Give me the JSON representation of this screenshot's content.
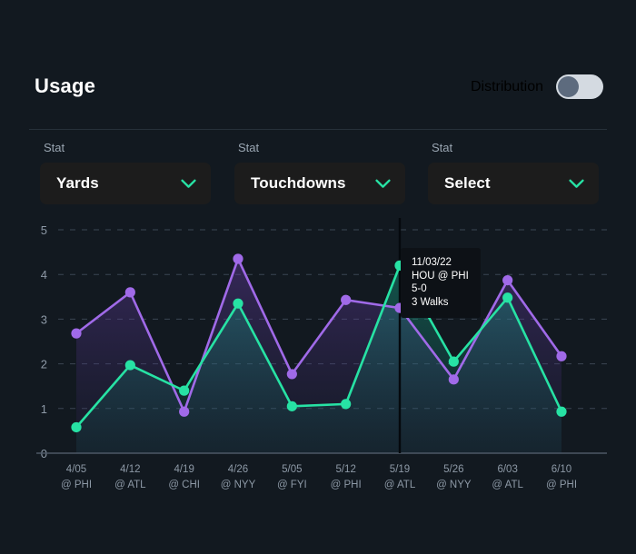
{
  "header": {
    "title": "Usage",
    "distribution_label": "Distribution",
    "toggle_state": "off"
  },
  "selectors": [
    {
      "label": "Stat",
      "value": "Yards",
      "icon": "chevron-down-icon"
    },
    {
      "label": "Stat",
      "value": "Touchdowns",
      "icon": "chevron-down-icon"
    },
    {
      "label": "Stat",
      "value": "Select",
      "icon": "chevron-down-icon"
    }
  ],
  "tooltip": {
    "date": "11/03/22",
    "matchup": "HOU @ PHI",
    "score": "5-0",
    "detail": "3 Walks"
  },
  "colors": {
    "background": "#121920",
    "series_1": "#a06ae8",
    "series_2": "#27e2a4",
    "accent": "#27e2a4",
    "grid": "#3b4653",
    "axis": "#4d5866",
    "marker_line": "#05090d",
    "panel": "#1c1c1c"
  },
  "chart_data": {
    "type": "line",
    "title": "Usage",
    "xlabel": "",
    "ylabel": "",
    "ylim": [
      0,
      5
    ],
    "yticks": [
      0,
      1,
      2,
      3,
      4,
      5
    ],
    "grid": true,
    "legend": "none",
    "filled": true,
    "categories": [
      "4/05 @ PHI",
      "4/12 @ ATL",
      "4/19 @ CHI",
      "4/26 @ NYY",
      "5/05 @ FYI",
      "5/12 @ PHI",
      "5/19 @ ATL",
      "5/26 @ NYY",
      "6/03 @ ATL",
      "6/10 @ PHI"
    ],
    "x_tick_dates": [
      "4/05",
      "4/12",
      "4/19",
      "4/26",
      "5/05",
      "5/12",
      "5/19",
      "5/26",
      "6/03",
      "6/10"
    ],
    "x_tick_opponents": [
      "@ PHI",
      "@ ATL",
      "@ CHI",
      "@ NYY",
      "@ FYI",
      "@ PHI",
      "@ ATL",
      "@ NYY",
      "@ ATL",
      "@ PHI"
    ],
    "series": [
      {
        "name": "Yards",
        "color": "#a06ae8",
        "values": [
          2.68,
          3.6,
          0.93,
          4.35,
          1.77,
          3.43,
          3.25,
          1.65,
          3.87,
          2.17
        ]
      },
      {
        "name": "Touchdowns",
        "color": "#27e2a4",
        "values": [
          0.58,
          1.97,
          1.4,
          3.35,
          1.05,
          1.1,
          4.2,
          2.05,
          3.48,
          0.93
        ]
      }
    ],
    "marker_line_category": "5/19 @ ATL",
    "annotation": {
      "date": "11/03/22",
      "matchup": "HOU @ PHI",
      "score": "5-0",
      "detail": "3 Walks"
    }
  }
}
